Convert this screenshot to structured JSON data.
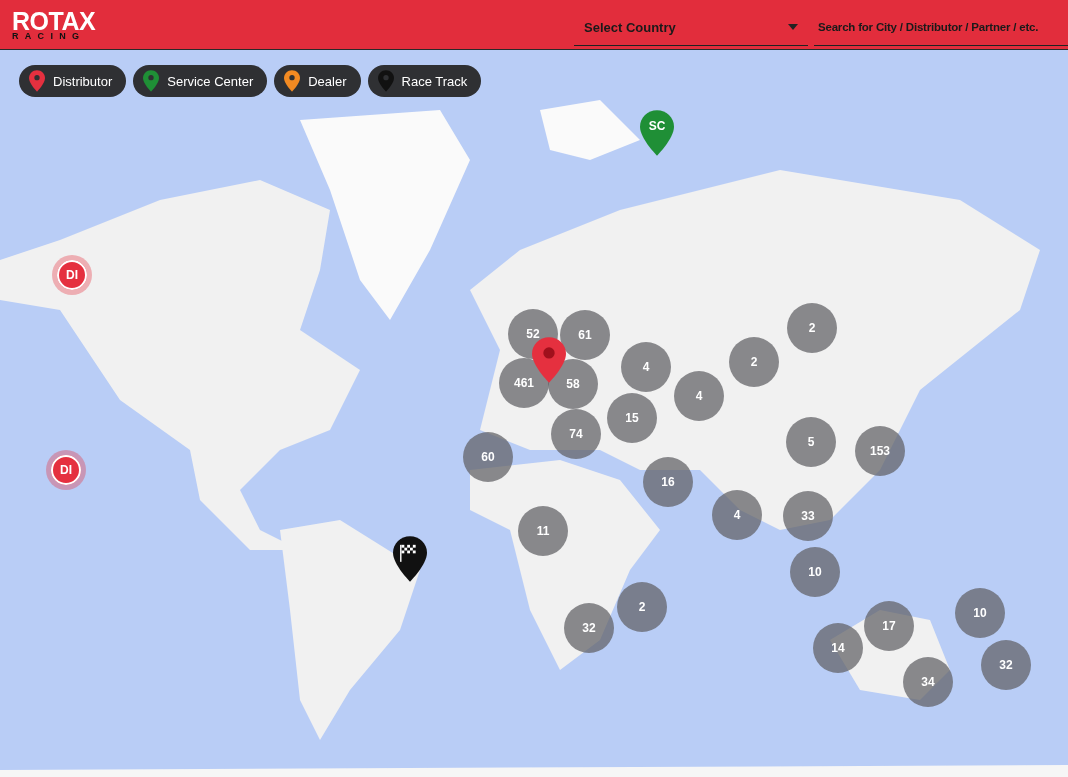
{
  "header": {
    "logo": {
      "title": "ROTAX",
      "subtitle": "RACING"
    },
    "country_select": {
      "value": "Select Country"
    },
    "search": {
      "placeholder": "Search for City / Distributor / Partner / etc."
    }
  },
  "legend": [
    {
      "label": "Distributor",
      "color": "#e5303f"
    },
    {
      "label": "Service Center",
      "color": "#1f8f36"
    },
    {
      "label": "Dealer",
      "color": "#f28a22"
    },
    {
      "label": "Race Track",
      "color": "#111111"
    }
  ],
  "map": {
    "kind": "picture",
    "markers": [
      {
        "kind": "cluster",
        "label": "52"
      },
      {
        "kind": "cluster",
        "label": "61"
      },
      {
        "kind": "cluster",
        "label": "461"
      },
      {
        "kind": "cluster",
        "label": "58"
      },
      {
        "kind": "cluster",
        "label": "4"
      },
      {
        "kind": "cluster",
        "label": "2"
      },
      {
        "kind": "cluster",
        "label": "2"
      },
      {
        "kind": "cluster",
        "label": "4"
      },
      {
        "kind": "cluster",
        "label": "15"
      },
      {
        "kind": "cluster",
        "label": "74"
      },
      {
        "kind": "cluster",
        "label": "60"
      },
      {
        "kind": "cluster",
        "label": "16"
      },
      {
        "kind": "cluster",
        "label": "5"
      },
      {
        "kind": "cluster",
        "label": "153"
      },
      {
        "kind": "cluster",
        "label": "4"
      },
      {
        "kind": "cluster",
        "label": "33"
      },
      {
        "kind": "cluster",
        "label": "11"
      },
      {
        "kind": "cluster",
        "label": "10"
      },
      {
        "kind": "cluster",
        "label": "2"
      },
      {
        "kind": "cluster",
        "label": "32"
      },
      {
        "kind": "cluster",
        "label": "17"
      },
      {
        "kind": "cluster",
        "label": "10"
      },
      {
        "kind": "cluster",
        "label": "14"
      },
      {
        "kind": "cluster",
        "label": "32"
      },
      {
        "kind": "cluster",
        "label": "34"
      },
      {
        "kind": "circle",
        "label": "DI",
        "color": "#e5303f"
      },
      {
        "kind": "circle",
        "label": "DI",
        "color": "#e5303f"
      },
      {
        "kind": "pin",
        "label": "SC",
        "color": "#1f8f36"
      },
      {
        "kind": "pin",
        "color": "#e5303f"
      },
      {
        "kind": "flag",
        "color": "#111111"
      }
    ]
  }
}
